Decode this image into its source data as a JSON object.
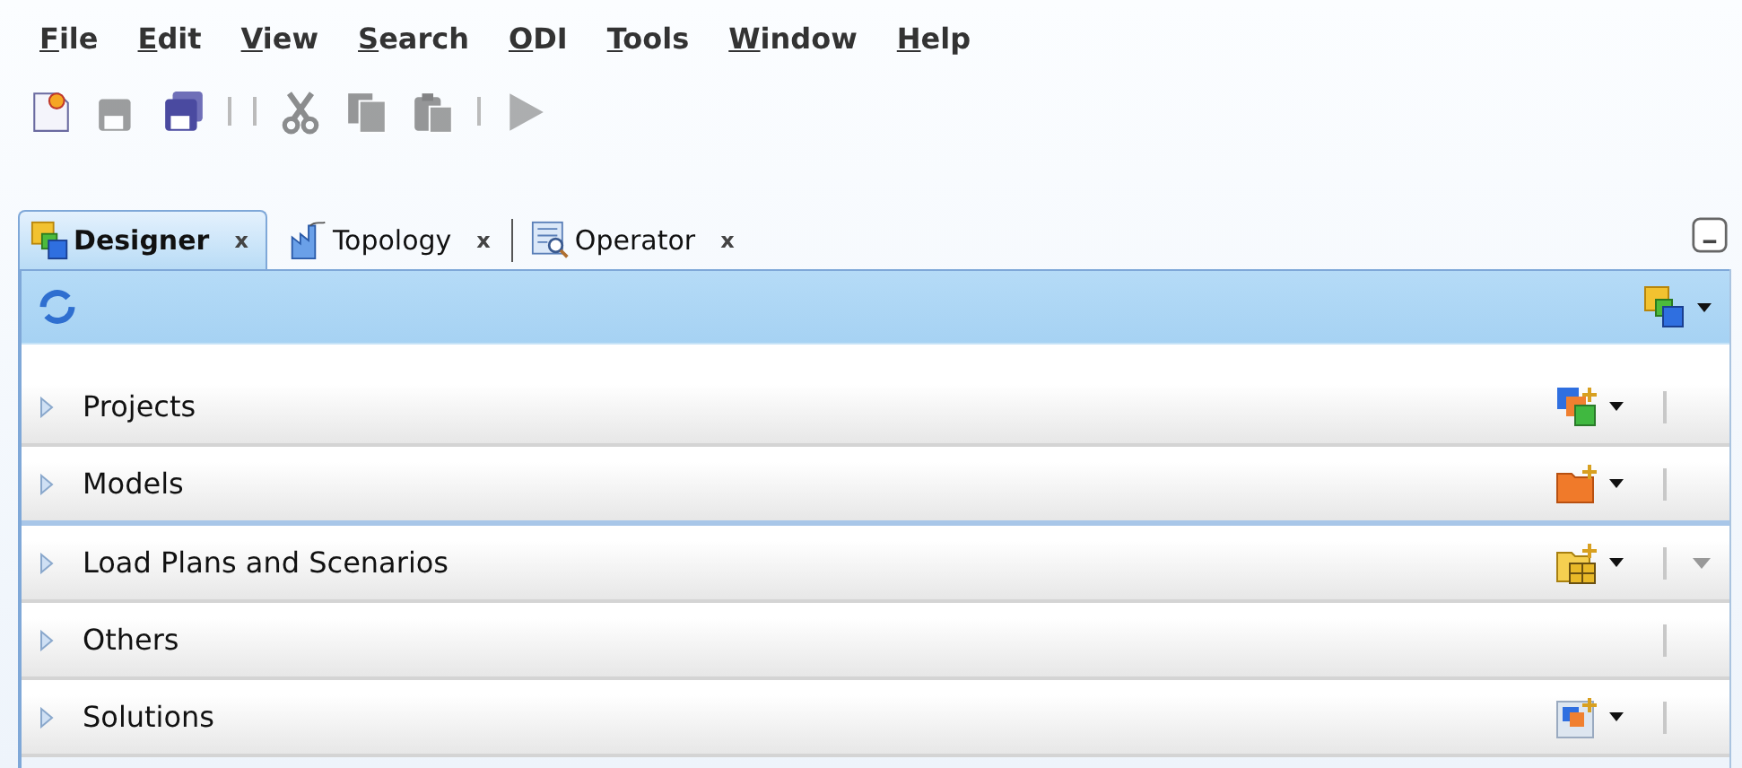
{
  "menu": [
    {
      "label": "File"
    },
    {
      "label": "Edit"
    },
    {
      "label": "View"
    },
    {
      "label": "Search"
    },
    {
      "label": "ODI"
    },
    {
      "label": "Tools"
    },
    {
      "label": "Window"
    },
    {
      "label": "Help"
    }
  ],
  "toolbar": [
    {
      "kind": "new",
      "disabled": false
    },
    {
      "kind": "save",
      "disabled": true
    },
    {
      "kind": "saveall",
      "disabled": false
    },
    {
      "kind": "separator"
    },
    {
      "kind": "separator"
    },
    {
      "kind": "cut",
      "disabled": true
    },
    {
      "kind": "copy",
      "disabled": true
    },
    {
      "kind": "paste",
      "disabled": true
    },
    {
      "kind": "separator"
    },
    {
      "kind": "run",
      "disabled": true
    }
  ],
  "tabs": [
    {
      "label": "Designer",
      "kind": "designer",
      "close": "x",
      "selected": true
    },
    {
      "label": "Topology",
      "kind": "topology",
      "close": "x",
      "selected": false
    },
    {
      "label": "Operator",
      "kind": "operator",
      "close": "x",
      "selected": false
    }
  ],
  "sections": [
    {
      "label": "Projects",
      "kind": "projects",
      "menu": true
    },
    {
      "label": "Models",
      "kind": "models",
      "menu": true
    },
    {
      "label": "Load Plans and Scenarios",
      "kind": "loadplans",
      "menu": true
    },
    {
      "label": "Others",
      "kind": "none",
      "menu": false
    },
    {
      "label": "Solutions",
      "kind": "solutions",
      "menu": true
    }
  ]
}
